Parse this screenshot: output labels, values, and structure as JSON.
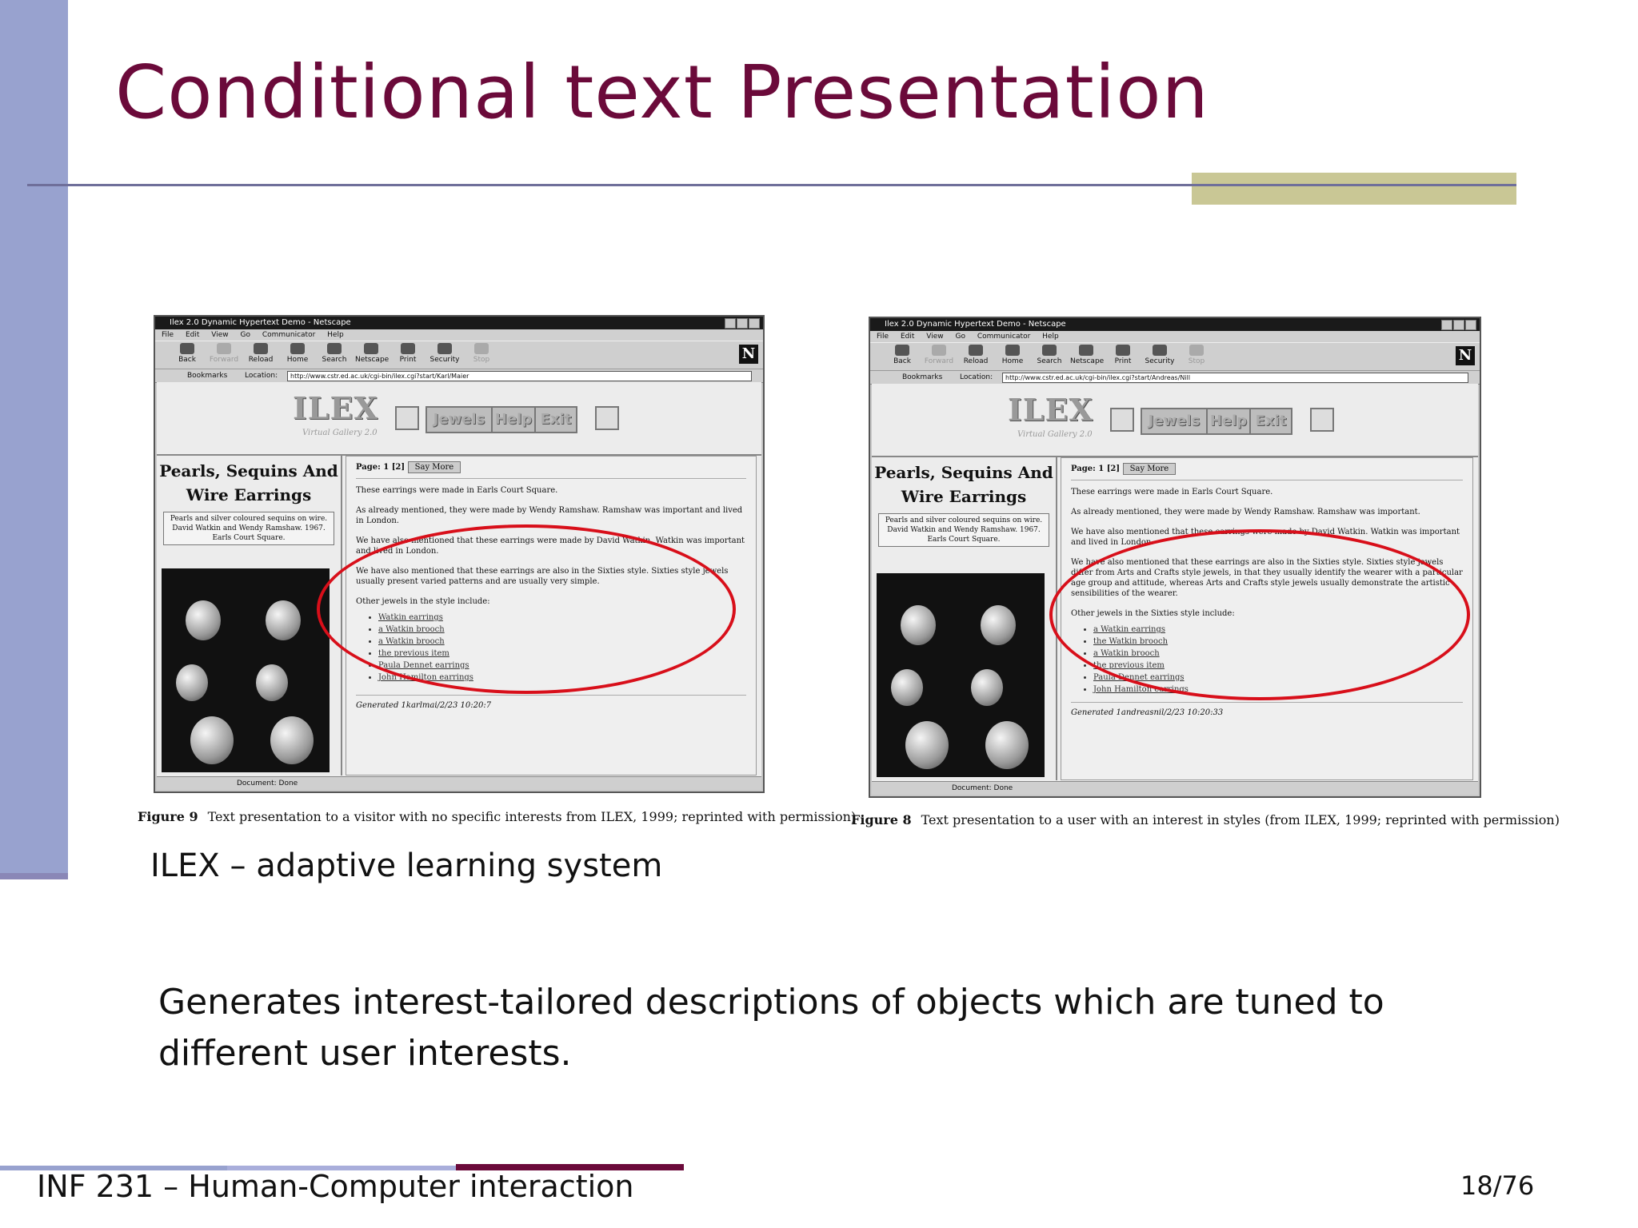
{
  "slide": {
    "title": "Conditional text Presentation",
    "sub_caption": "ILEX – adaptive learning system",
    "body_text": "Generates interest-tailored descriptions of objects  which are tuned to different user interests.",
    "footer_course": "INF 231 – Human-Computer interaction",
    "page_number": "18/76",
    "colors": {
      "title": "#6b0a3a",
      "left_bar": "#98a2cf",
      "accent": "#c9c795",
      "highlight_ellipse": "#d80f1a"
    }
  },
  "figures": [
    {
      "window_title": "Ilex 2.0 Dynamic Hypertext Demo - Netscape",
      "menu": [
        "File",
        "Edit",
        "View",
        "Go",
        "Communicator",
        "Help"
      ],
      "toolbar": [
        "Back",
        "Forward",
        "Reload",
        "Home",
        "Search",
        "Netscape",
        "Print",
        "Security",
        "Stop"
      ],
      "bookmarks_label": "Bookmarks",
      "location_label": "Location:",
      "url": "http://www.cstr.ed.ac.uk/cgi-bin/ilex.cgi?start/Karl/Maier",
      "logo": "ILEX",
      "logo_sub": "Virtual Gallery 2.0",
      "nav": [
        "Jewels",
        "Help",
        "Exit"
      ],
      "item_title": "Pearls, Sequins And Wire Earrings",
      "item_caption": "Pearls and silver coloured sequins on wire. David Watkin and Wendy Ramshaw. 1967. Earls Court Square.",
      "page_label": "Page:",
      "page_links": "1 [2]",
      "say_more": "Say More",
      "paragraphs": [
        "These earrings were made in Earls Court Square.",
        "As already mentioned, they were made by Wendy Ramshaw. Ramshaw was important and lived in London.",
        "We have also mentioned that these earrings were made by David Watkin. Watkin was important and lived in London.",
        "We have also mentioned that these earrings are also in the Sixties style. Sixties style jewels usually present varied patterns and are usually very simple.",
        "Other jewels in the style include:"
      ],
      "links": [
        "Watkin earrings",
        "a Watkin brooch",
        "a Watkin brooch",
        "the previous item",
        "Paula Dennet earrings",
        "John Hamilton earrings"
      ],
      "generated": "Generated 1karlmai/2/23 10:20:7",
      "status": "Document: Done",
      "caption_label": "Figure 9",
      "caption_text": "Text presentation to a visitor with no specific interests from ILEX, 1999; reprinted with permission)"
    },
    {
      "window_title": "Ilex 2.0 Dynamic Hypertext Demo - Netscape",
      "menu": [
        "File",
        "Edit",
        "View",
        "Go",
        "Communicator",
        "Help"
      ],
      "toolbar": [
        "Back",
        "Forward",
        "Reload",
        "Home",
        "Search",
        "Netscape",
        "Print",
        "Security",
        "Stop"
      ],
      "bookmarks_label": "Bookmarks",
      "location_label": "Location:",
      "url": "http://www.cstr.ed.ac.uk/cgi-bin/ilex.cgi?start/Andreas/Nill",
      "logo": "ILEX",
      "logo_sub": "Virtual Gallery 2.0",
      "nav": [
        "Jewels",
        "Help",
        "Exit"
      ],
      "item_title": "Pearls, Sequins And Wire Earrings",
      "item_caption": "Pearls and silver coloured sequins on wire. David Watkin and Wendy Ramshaw. 1967. Earls Court Square.",
      "page_label": "Page:",
      "page_links": "1 [2]",
      "say_more": "Say More",
      "paragraphs": [
        "These earrings were made in Earls Court Square.",
        "As already mentioned, they were made by Wendy Ramshaw. Ramshaw was important.",
        "We have also mentioned that these earrings were made by David Watkin. Watkin was important and lived in London.",
        "We have also mentioned that these earrings are also in the Sixties style. Sixties style jewels differ from Arts and Crafts style jewels, in that they usually identify the wearer with a particular age group and attitude, whereas Arts and Crafts style jewels usually demonstrate the artistic sensibilities of the wearer.",
        "Other jewels in the Sixties style include:"
      ],
      "links": [
        "a Watkin earrings",
        "the Watkin brooch",
        "a Watkin brooch",
        "the previous item",
        "Paula Dennet earrings",
        "John Hamilton earrings"
      ],
      "generated": "Generated 1andreasnil/2/23 10:20:33",
      "status": "Document: Done",
      "caption_label": "Figure 8",
      "caption_text": "Text presentation to a user with an interest in styles (from ILEX, 1999; reprinted with permission)"
    }
  ]
}
